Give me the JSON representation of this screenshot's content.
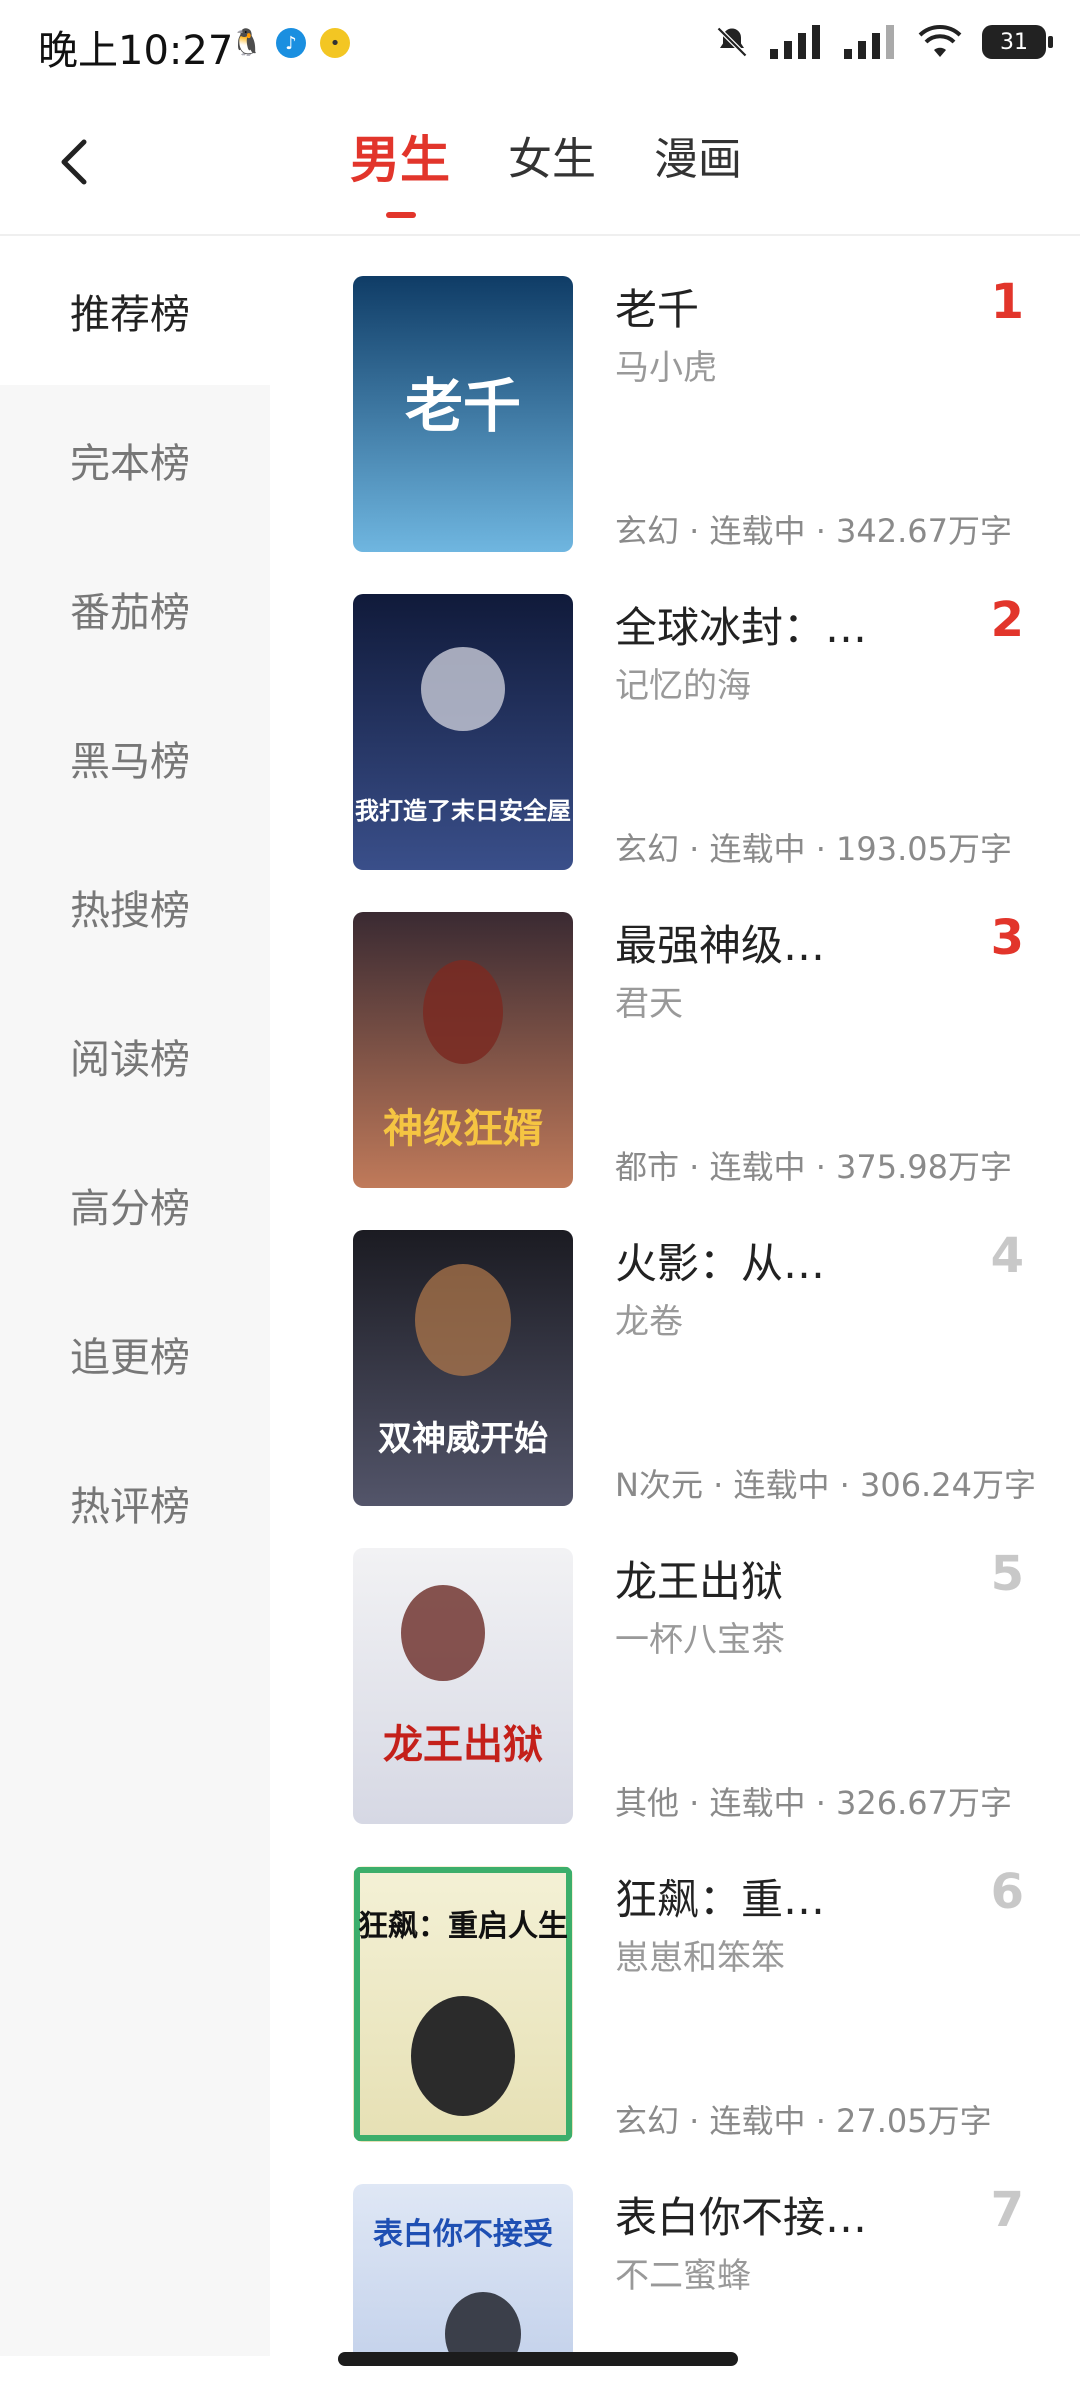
{
  "status_bar": {
    "time": "晚上10:27",
    "battery": "31"
  },
  "header": {
    "tabs": [
      {
        "label": "男生",
        "active": true
      },
      {
        "label": "女生",
        "active": false
      },
      {
        "label": "漫画",
        "active": false
      }
    ]
  },
  "sidebar": {
    "items": [
      {
        "label": "推荐榜",
        "active": true
      },
      {
        "label": "完本榜"
      },
      {
        "label": "番茄榜"
      },
      {
        "label": "黑马榜"
      },
      {
        "label": "热搜榜"
      },
      {
        "label": "阅读榜"
      },
      {
        "label": "高分榜"
      },
      {
        "label": "追更榜"
      },
      {
        "label": "热评榜"
      }
    ]
  },
  "books": [
    {
      "rank": "1",
      "title": "老千",
      "author": "马小虎",
      "meta": "玄幻 · 连载中 · 342.67万字",
      "cover_text": "老千",
      "cover_colors": [
        "#0f3c66",
        "#6fb6e0"
      ]
    },
    {
      "rank": "2",
      "title": "全球冰封：…",
      "author": "记忆的海",
      "meta": "玄幻 · 连载中 · 193.05万字",
      "cover_text": "我打造了末日安全屋",
      "cover_colors": [
        "#101a3a",
        "#3a4f8a"
      ]
    },
    {
      "rank": "3",
      "title": "最强神级…",
      "author": "君天",
      "meta": "都市 · 连载中 · 375.98万字",
      "cover_text": "神级狂婿",
      "cover_colors": [
        "#3a2a32",
        "#c07a5a"
      ]
    },
    {
      "rank": "4",
      "title": "火影：从…",
      "author": "龙卷",
      "meta": "N次元 · 连载中 · 306.24万字",
      "cover_text": "双神威开始",
      "cover_colors": [
        "#1b1b22",
        "#53556a"
      ]
    },
    {
      "rank": "5",
      "title": "龙王出狱",
      "author": "一杯八宝茶",
      "meta": "其他 · 连载中 · 326.67万字",
      "cover_text": "龙王出狱",
      "cover_colors": [
        "#f2f2f4",
        "#d6d8e4"
      ]
    },
    {
      "rank": "6",
      "title": "狂飙：重…",
      "author": "崽崽和笨笨",
      "meta": "玄幻 · 连载中 · 27.05万字",
      "cover_text": "狂飙：重启人生",
      "cover_colors": [
        "#f4f1d6",
        "#e6e0b4"
      ]
    },
    {
      "rank": "7",
      "title": "表白你不接…",
      "author": "不二蜜蜂",
      "meta": "",
      "cover_text": "表白你不接受",
      "cover_colors": [
        "#dfe7f5",
        "#b6c7e6"
      ]
    }
  ]
}
